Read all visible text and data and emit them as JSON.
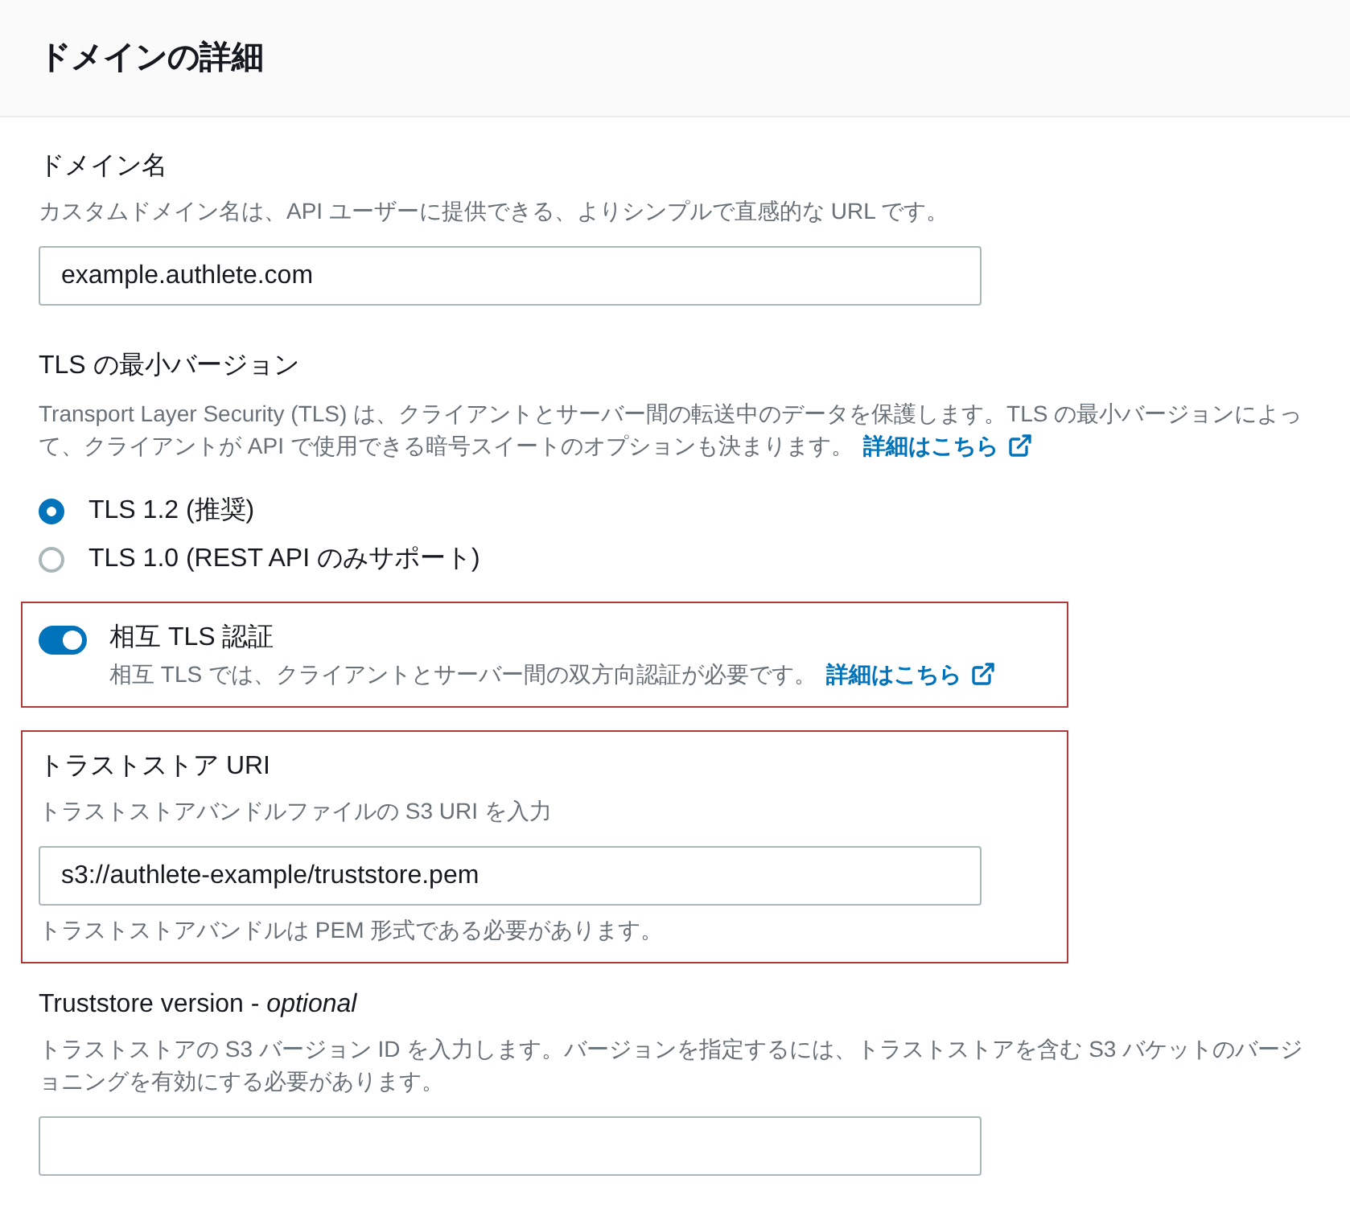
{
  "panel": {
    "title": "ドメインの詳細"
  },
  "fields": [
    {
      "kind": "text",
      "label": "ドメイン名",
      "description": "カスタムドメイン名は、API ユーザーに提供できる、よりシンプルで直感的な URL です。",
      "value": "example.authlete.com",
      "highlighted": false
    },
    {
      "kind": "radio",
      "label": "TLS の最小バージョン",
      "description": "Transport Layer Security (TLS) は、クライアントとサーバー間の転送中のデータを保護します。TLS の最小バージョンによって、クライアントが API で使用できる暗号スイートのオプションも決まります。",
      "link": "詳細はこちら",
      "options": [
        {
          "label": "TLS 1.2 (推奨)",
          "selected": true
        },
        {
          "label": "TLS 1.0 (REST API のみサポート)",
          "selected": false
        }
      ],
      "highlighted": false
    },
    {
      "kind": "toggle",
      "label": "相互 TLS 認証",
      "description": "相互 TLS では、クライアントとサーバー間の双方向認証が必要です。",
      "link": "詳細はこちら",
      "on": true,
      "highlighted": true
    },
    {
      "kind": "text",
      "label": "トラストストア URI",
      "description": "トラストストアバンドルファイルの S3 URI を入力",
      "value": "s3://authlete-example/truststore.pem",
      "constraint": "トラストストアバンドルは PEM 形式である必要があります。",
      "highlighted": true
    },
    {
      "kind": "text",
      "label": "Truststore version - *optional*",
      "description": "トラストストアの S3 バージョン ID を入力します。バージョンを指定するには、トラストストアを含む S3 バケットのバージョニングを有効にする必要があります。",
      "highlighted": false
    }
  ]
}
